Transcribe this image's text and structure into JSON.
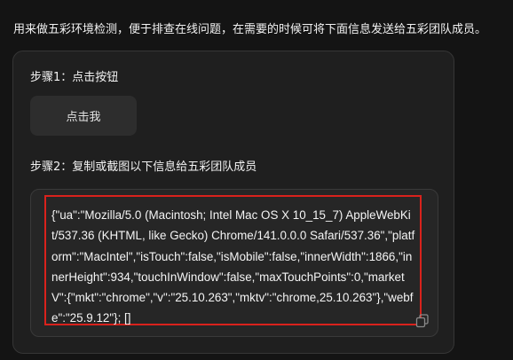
{
  "intro": {
    "text": "用来做五彩环境检测，便于排查在线问题，在需要的时候可将下面信息发送给五彩团队成员。"
  },
  "step1": {
    "title": "步骤1：点击按钮",
    "button_label": "点击我"
  },
  "step2": {
    "title": "步骤2：复制或截图以下信息给五彩团队成员",
    "info": "{\"ua\":\"Mozilla/5.0 (Macintosh; Intel Mac OS X 10_15_7) AppleWebKit/537.36 (KHTML, like Gecko) Chrome/141.0.0.0 Safari/537.36\",\"platform\":\"MacIntel\",\"isTouch\":false,\"isMobile\":false,\"innerWidth\":1866,\"innerHeight\":934,\"touchInWindow\":false,\"maxTouchPoints\":0,\"marketV\":{\"mkt\":\"chrome\",\"v\":\"25.10.263\",\"mktv\":\"chrome,25.10.263\"},\"webfe\":\"25.9.12\"}; []",
    "copy_icon": "copy-icon"
  },
  "colors": {
    "background": "#141414",
    "panel": "#1f1f1f",
    "highlight_border": "#d9221c"
  }
}
